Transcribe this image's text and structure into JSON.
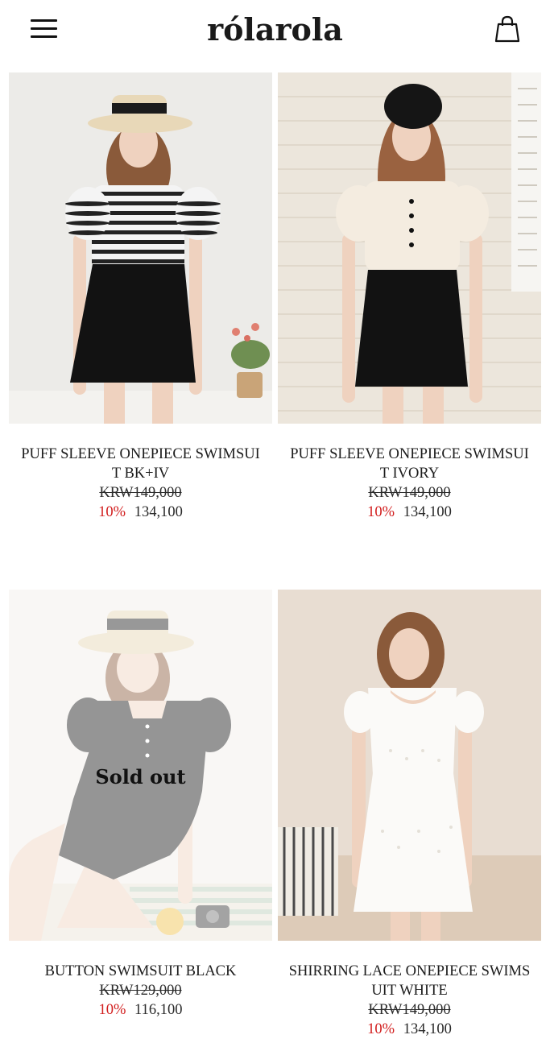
{
  "header": {
    "logo": "rólarola",
    "menu_icon": "hamburger-menu-icon",
    "cart_icon": "shopping-bag-icon"
  },
  "products": [
    {
      "name_line1": "PUFF SLEEVE ONEPIECE SWIMSUI",
      "name_line2": "T BK+IV",
      "original_price": "KRW149,000",
      "discount": "10%",
      "sale_price": "134,100",
      "sold_out": ""
    },
    {
      "name_line1": "PUFF SLEEVE ONEPIECE SWIMSUI",
      "name_line2": "T IVORY",
      "original_price": "KRW149,000",
      "discount": "10%",
      "sale_price": "134,100",
      "sold_out": ""
    },
    {
      "name_line1": "BUTTON SWIMSUIT BLACK",
      "name_line2": "",
      "original_price": "KRW129,000",
      "discount": "10%",
      "sale_price": "116,100",
      "sold_out": "Sold out"
    },
    {
      "name_line1": "SHIRRING LACE ONEPIECE SWIMS",
      "name_line2": "UIT WHITE",
      "original_price": "KRW149,000",
      "discount": "10%",
      "sale_price": "134,100",
      "sold_out": ""
    }
  ],
  "colors": {
    "discount": "#d21e1e",
    "text": "#222222"
  }
}
